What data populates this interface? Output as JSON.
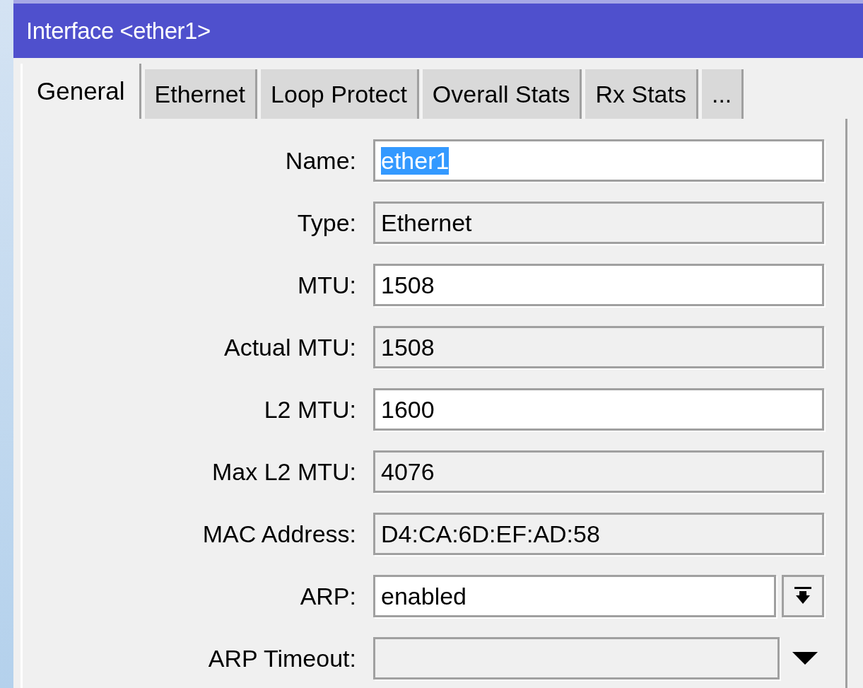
{
  "window": {
    "title": "Interface <ether1>"
  },
  "tabs": [
    {
      "label": "General",
      "selected": true
    },
    {
      "label": "Ethernet",
      "selected": false
    },
    {
      "label": "Loop Protect",
      "selected": false
    },
    {
      "label": "Overall Stats",
      "selected": false
    },
    {
      "label": "Rx Stats",
      "selected": false
    },
    {
      "label": "...",
      "selected": false
    }
  ],
  "fields": [
    {
      "label": "Name:",
      "value": "ether1",
      "kind": "text",
      "text_selected": true
    },
    {
      "label": "Type:",
      "value": "Ethernet",
      "kind": "readonly",
      "text_selected": false
    },
    {
      "label": "MTU:",
      "value": "1508",
      "kind": "text",
      "text_selected": false
    },
    {
      "label": "Actual MTU:",
      "value": "1508",
      "kind": "readonly",
      "text_selected": false
    },
    {
      "label": "L2 MTU:",
      "value": "1600",
      "kind": "text",
      "text_selected": false
    },
    {
      "label": "Max L2 MTU:",
      "value": "4076",
      "kind": "readonly",
      "text_selected": false
    },
    {
      "label": "MAC Address:",
      "value": "D4:CA:6D:EF:AD:58",
      "kind": "readonly",
      "text_selected": false
    },
    {
      "label": "ARP:",
      "value": "enabled",
      "kind": "select",
      "text_selected": false
    },
    {
      "label": "ARP Timeout:",
      "kind": "readonly-expand"
    }
  ]
}
